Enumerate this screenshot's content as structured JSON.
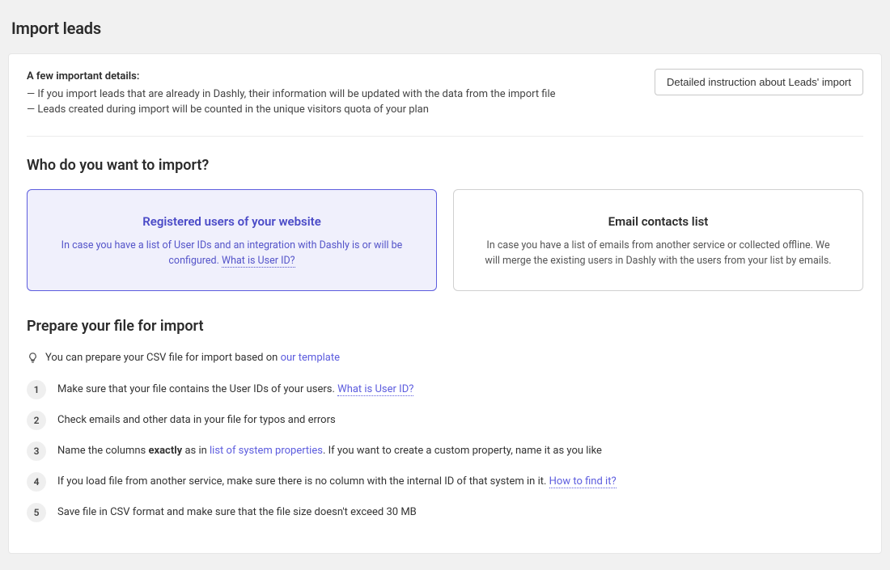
{
  "page_title": "Import leads",
  "details": {
    "title": "A few important details:",
    "line1": "— If you import leads that are already in Dashly, their information will be updated with the data from the import file",
    "line2": "— Leads created during import will be counted in the unique visitors quota of your plan"
  },
  "instruction_button": "Detailed instruction about Leads' import",
  "who_section_title": "Who do you want to import?",
  "option1": {
    "title": "Registered users of your website",
    "desc_a": "In case you have a list of User IDs and an integration with Dashly is or will be configured. ",
    "desc_link": "What is User ID?"
  },
  "option2": {
    "title": "Email contacts list",
    "desc": "In case you have a list of emails from another service or collected offline. We will merge the existing users in Dashly with the users from your list by emails."
  },
  "prepare_section_title": "Prepare your file for import",
  "tip_prefix": "You can prepare your CSV file for import based on ",
  "tip_link": "our template",
  "steps": {
    "s1_a": "Make sure that your file contains the User IDs of your users. ",
    "s1_link": "What is User ID?",
    "s2": "Check emails and other data in your file for typos and errors",
    "s3_a": "Name the columns ",
    "s3_bold": "exactly",
    "s3_b": " as in ",
    "s3_link": "list of system properties",
    "s3_c": ". If you want to create a custom property, name it as you like",
    "s4_a": "If you load file from another service, make sure there is no column with the internal ID of that system in it. ",
    "s4_link": "How to find it?",
    "s5": "Save file in CSV format and make sure that the file size doesn't exceed 30 MB"
  }
}
